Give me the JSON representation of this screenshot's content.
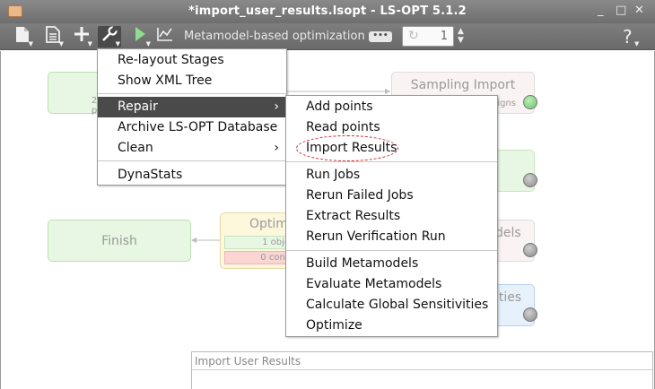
{
  "window": {
    "title": "*import_user_results.lsopt - LS-OPT 5.1.2",
    "controls": [
      "_",
      "□",
      "✕"
    ]
  },
  "toolbar": {
    "mode_label": "Metamodel-based optimization",
    "iteration_value": "1"
  },
  "stages": {
    "setup_sub": "2 p",
    "sampling_title": "Sampling Import",
    "sampling_sub": "signs",
    "finish": "Finish",
    "optimization_title": "Optim",
    "optimization_obj": "1 obje",
    "optimization_cons": "0 cons",
    "metamodels_partial": "dels",
    "sensitivities_partial": "ities"
  },
  "main_menu": [
    {
      "label": "Re-layout Stages"
    },
    {
      "label": "Show XML Tree"
    },
    {
      "label": "Repair",
      "submenu": true,
      "highlighted": true
    },
    {
      "label": "Archive LS-OPT Database"
    },
    {
      "label": "Clean",
      "submenu": true
    },
    {
      "label": "DynaStats"
    }
  ],
  "repair_menu": [
    {
      "label": "Add points"
    },
    {
      "label": "Read points"
    },
    {
      "label": "Import Results"
    },
    {
      "label": "Run Jobs"
    },
    {
      "label": "Rerun Failed Jobs"
    },
    {
      "label": "Extract Results"
    },
    {
      "label": "Rerun Verification Run"
    },
    {
      "label": "Build Metamodels"
    },
    {
      "label": "Evaluate Metamodels"
    },
    {
      "label": "Calculate Global Sensitivities"
    },
    {
      "label": "Optimize"
    }
  ],
  "status_panel": {
    "label": "Import User Results"
  },
  "colors": {
    "highlight": "#4a4a4a",
    "callout": "#d02020",
    "status_green": "#6cc46c",
    "status_gray": "#8a8a8a",
    "finish_fill": "#e8f7e4",
    "optim_fill": "#fdf7dc",
    "cons_fill": "#fbd4d4"
  }
}
